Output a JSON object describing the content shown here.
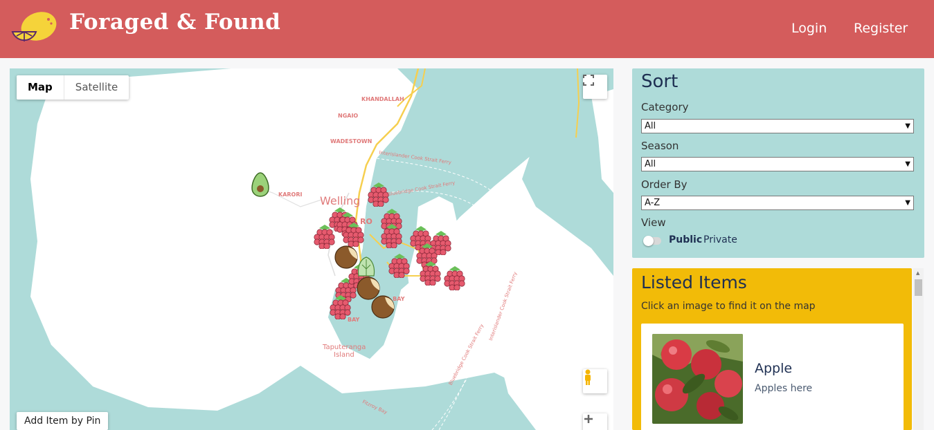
{
  "header": {
    "brand": "Foraged & Found",
    "login": "Login",
    "register": "Register",
    "bg_color": "#d45c5c"
  },
  "map": {
    "type_buttons": [
      "Map",
      "Satellite"
    ],
    "add_pin": "Add Item by Pin",
    "labels": {
      "khandallah": "KHANDALLAH",
      "ngaio": "NGAIO",
      "wadestown": "WADESTOWN",
      "karori": "KARORI",
      "wellington": "Welling",
      "ro": "RO",
      "all_bay": "ALL BAY",
      "bay": "BAY",
      "island1": "Taputeranga",
      "island2": "Island",
      "ferry1": "Interislander Cook Strait Ferry",
      "ferry2": "Bluebridge Cook Strait Ferry",
      "ferry3": "Bluebridge Cook Strait Ferry",
      "ferry4": "Interislander Cook Strait Ferry",
      "fitzroy": "Fitzroy Bay"
    }
  },
  "sort": {
    "title": "Sort",
    "category_label": "Category",
    "category_value": "All",
    "season_label": "Season",
    "season_value": "All",
    "order_label": "Order By",
    "order_value": "A-Z",
    "view_label": "View",
    "view_public": "Public",
    "view_private": "Private"
  },
  "listed": {
    "title": "Listed Items",
    "subtitle": "Click an image to find it on the map",
    "items": [
      {
        "name": "Apple",
        "description": "Apples here"
      }
    ]
  }
}
